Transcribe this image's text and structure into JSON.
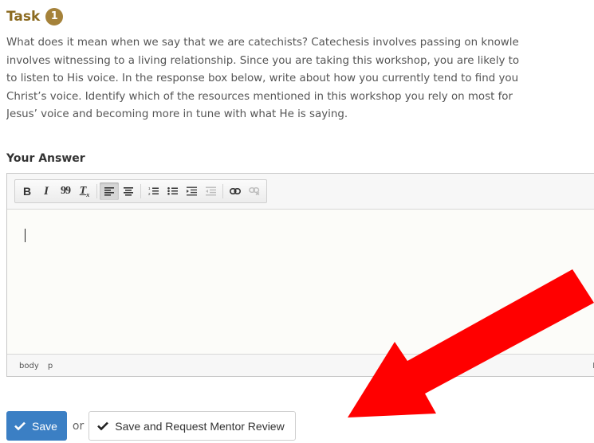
{
  "task": {
    "title": "Task",
    "number": "1",
    "description_lines": [
      "What does it mean when we say that we are catechists? Catechesis involves passing on knowle",
      "involves witnessing to a living relationship. Since you are taking this workshop, you are likely to",
      "to listen to His voice. In the response box below, write about how you currently tend to find you",
      "Christ’s voice. Identify which of the resources mentioned in this workshop you rely on most for",
      "Jesus’ voice and becoming more in tune with what He is saying."
    ]
  },
  "answer": {
    "label": "Your Answer",
    "toolbar": {
      "bold": "B",
      "italic": "I",
      "blockquote": "99",
      "remove_format": "Tx"
    },
    "statusbar": {
      "path": [
        "body",
        "p"
      ],
      "right": "F"
    }
  },
  "actions": {
    "save_label": "Save",
    "or_label": "or",
    "mentor_label": "Save and Request Mentor Review"
  },
  "colors": {
    "accent_gold": "#a5823a",
    "title_gold": "#8b6a1f",
    "primary_blue": "#3b7fc4",
    "arrow_red": "#ff0000"
  }
}
